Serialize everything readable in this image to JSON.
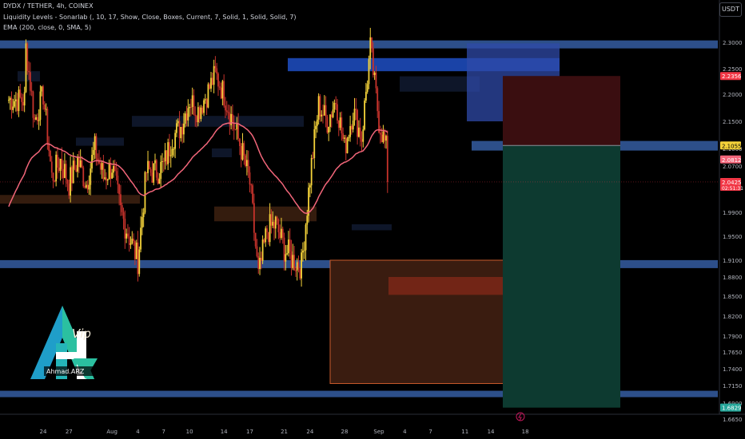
{
  "header": {
    "symbol_line": "DYDX / TETHER, 4h, COINEX",
    "indicator_1": "Liquidity Levels - Sonarlab (, 10, 17, Show, Close, Boxes, Current, 7, Solid, 1, Solid, Solid, 7)",
    "indicator_2": "EMA (200, close, 0, SMA, 5)"
  },
  "currency_button": "USDT",
  "logo": {
    "signature": "Ahmad.ARZ",
    "script_text": "Vip"
  },
  "colors": {
    "background": "#000000",
    "candle_up": "#f5d33a",
    "candle_down": "#c7332c",
    "ema": "#f2667a",
    "liquidity_box": "#2d4f8a",
    "supply_zone": "#3a1f10",
    "target_zone": "#0d3a30",
    "stop_zone": "#3a0e10"
  },
  "chart_data": {
    "type": "candlestick",
    "symbol": "DYDX / TETHER",
    "timeframe": "4h",
    "exchange": "COINEX",
    "y_ticks": [
      2.3,
      2.25,
      2.2,
      2.15,
      2.1,
      2.07,
      1.99,
      1.95,
      1.91,
      1.88,
      1.85,
      1.82,
      1.79,
      1.765,
      1.74,
      1.715,
      1.69,
      1.665
    ],
    "y_tick_labels": [
      "2.3000",
      "2.2500",
      "2.2000",
      "2.1500",
      "2.1000",
      "2.0700",
      "1.9900",
      "1.9500",
      "1.9100",
      "1.8800",
      "1.8500",
      "1.8200",
      "1.7900",
      "1.7650",
      "1.7400",
      "1.7150",
      "1.6900",
      "1.6650"
    ],
    "x_tick_labels": [
      "24",
      "27",
      "Aug",
      "4",
      "7",
      "10",
      "14",
      "17",
      "21",
      "24",
      "28",
      "Sep",
      "4",
      "7",
      "11",
      "14",
      "18"
    ],
    "price_labels": [
      {
        "text": "2.2356",
        "value": 2.2356,
        "color": "#f23645"
      },
      {
        "text": "2.1055",
        "value": 2.1055,
        "color": "#f5d33a"
      },
      {
        "text": "2.0812",
        "value": 2.0812,
        "color": "#f2667a"
      },
      {
        "text": "2.0425",
        "value": 2.0425,
        "color": "#f23645",
        "sub": "02:51:31"
      },
      {
        "text": "1.6829",
        "value": 1.6829,
        "color": "#26a69a"
      }
    ],
    "current_price": 2.0425,
    "ema_period": 200,
    "liquidity_levels": [
      2.296,
      2.105,
      1.903,
      1.703
    ],
    "position": {
      "type": "short",
      "entry": 2.1055,
      "stop": 2.2356,
      "target": 1.6829
    },
    "price_path": [
      {
        "x": "Jul 22",
        "y": 2.19
      },
      {
        "x": "Jul 22",
        "y": 2.29
      },
      {
        "x": "Jul 23",
        "y": 2.15
      },
      {
        "x": "Jul 24",
        "y": 2.2
      },
      {
        "x": "Jul 25",
        "y": 2.05
      },
      {
        "x": "Jul 26",
        "y": 2.08
      },
      {
        "x": "Jul 27",
        "y": 2.04
      },
      {
        "x": "Jul 28",
        "y": 2.08
      },
      {
        "x": "Jul 29",
        "y": 2.04
      },
      {
        "x": "Jul 30",
        "y": 2.1
      },
      {
        "x": "Jul 31",
        "y": 2.05
      },
      {
        "x": "Aug 1",
        "y": 2.07
      },
      {
        "x": "Aug 2",
        "y": 1.99
      },
      {
        "x": "Aug 3",
        "y": 1.95
      },
      {
        "x": "Aug 4",
        "y": 1.91
      },
      {
        "x": "Aug 5",
        "y": 2.06
      },
      {
        "x": "Aug 6",
        "y": 2.06
      },
      {
        "x": "Aug 7",
        "y": 2.07
      },
      {
        "x": "Aug 8",
        "y": 2.12
      },
      {
        "x": "Aug 9",
        "y": 2.14
      },
      {
        "x": "Aug 10",
        "y": 2.19
      },
      {
        "x": "Aug 11",
        "y": 2.17
      },
      {
        "x": "Aug 12",
        "y": 2.2
      },
      {
        "x": "Aug 13",
        "y": 2.24
      },
      {
        "x": "Aug 14",
        "y": 2.2
      },
      {
        "x": "Aug 15",
        "y": 2.15
      },
      {
        "x": "Aug 16",
        "y": 2.1
      },
      {
        "x": "Aug 17",
        "y": 2.04
      },
      {
        "x": "Aug 18",
        "y": 1.88
      },
      {
        "x": "Aug 19",
        "y": 1.96
      },
      {
        "x": "Aug 20",
        "y": 1.97
      },
      {
        "x": "Aug 21",
        "y": 1.93
      },
      {
        "x": "Aug 22",
        "y": 1.91
      },
      {
        "x": "Aug 23",
        "y": 1.9
      },
      {
        "x": "Aug 24",
        "y": 2.05
      },
      {
        "x": "Aug 25",
        "y": 2.18
      },
      {
        "x": "Aug 26",
        "y": 2.15
      },
      {
        "x": "Aug 27",
        "y": 2.19
      },
      {
        "x": "Aug 28",
        "y": 2.1
      },
      {
        "x": "Aug 29",
        "y": 2.17
      },
      {
        "x": "Aug 30",
        "y": 2.12
      },
      {
        "x": "Aug 31",
        "y": 2.29
      },
      {
        "x": "Sep 1",
        "y": 2.15
      },
      {
        "x": "Sep 2",
        "y": 2.09
      },
      {
        "x": "Sep 2",
        "y": 2.0425
      }
    ]
  }
}
